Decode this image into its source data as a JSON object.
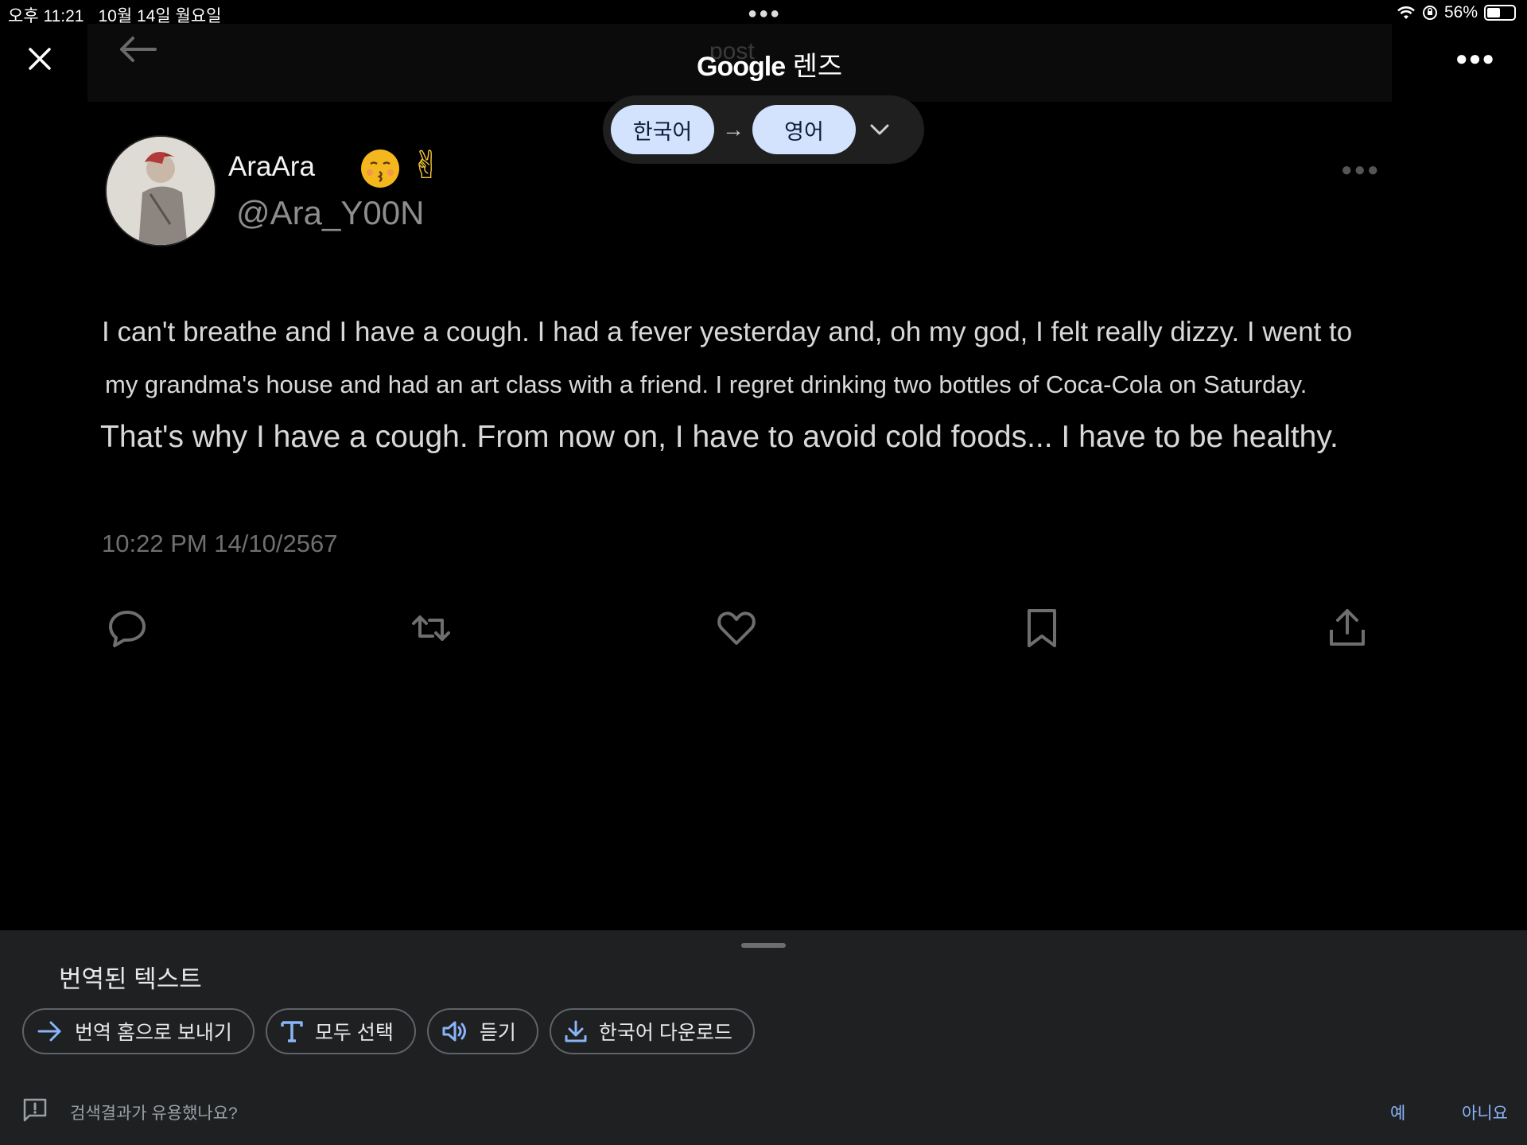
{
  "status_bar": {
    "time": "오후 11:21",
    "date": "10월 14일 월요일",
    "battery": "56%",
    "battery_level": 0.56
  },
  "lens_header": {
    "ghost_text": "post",
    "brand": "Google",
    "product": "렌즈"
  },
  "language": {
    "source": "한국어",
    "target": "영어"
  },
  "tweet": {
    "display_name": "AraAra",
    "handle": "@Ara_Y00N",
    "lines": [
      "I can't breathe and I have a cough. I had a fever yesterday and, oh my god, I felt really dizzy. I went to",
      "my grandma's house and had an art class with a friend. I regret drinking two bottles of Coca-Cola on Saturday.",
      "That's why I have a cough. From now on, I have to avoid cold foods... I have to be healthy."
    ],
    "timestamp": "10:22 PM 14/10/2567"
  },
  "sheet": {
    "title": "번역된 텍스트",
    "chips": [
      {
        "label": "번역 홈으로 보내기",
        "icon": "arrow-right-icon"
      },
      {
        "label": "모두 선택",
        "icon": "text-select-icon"
      },
      {
        "label": "듣기",
        "icon": "speaker-icon"
      },
      {
        "label": "한국어 다운로드",
        "icon": "download-icon"
      }
    ],
    "feedback_question": "검색결과가 유용했나요?",
    "feedback_yes": "예",
    "feedback_no": "아니요"
  },
  "colors": {
    "chip_bg": "#d3e3fd",
    "sheet_bg": "#1f2022",
    "link": "#8ab4f8"
  }
}
